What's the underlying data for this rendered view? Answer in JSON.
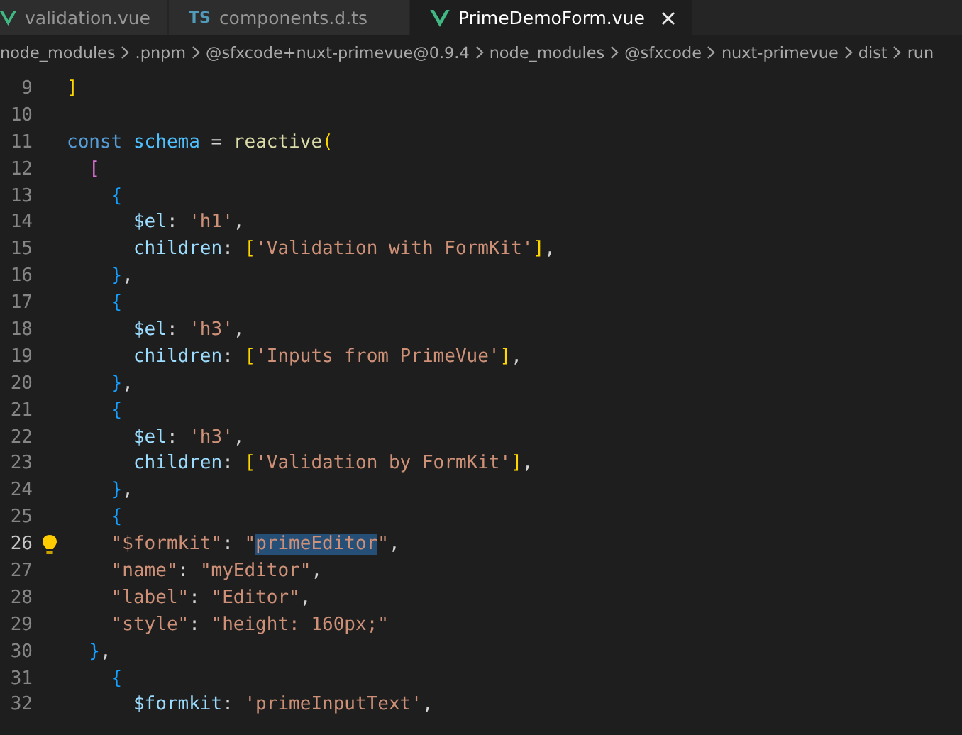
{
  "tabs": [
    {
      "label": "validation.vue",
      "kind": "vue",
      "selected": false
    },
    {
      "label": "components.d.ts",
      "kind": "ts",
      "icon_text": "TS",
      "selected": false
    },
    {
      "label": "PrimeDemoForm.vue",
      "kind": "vue",
      "selected": true
    }
  ],
  "breadcrumb": [
    "node_modules",
    ".pnpm",
    "@sfxcode+nuxt-primevue@0.9.4",
    "node_modules",
    "@sfxcode",
    "nuxt-primevue",
    "dist",
    "run"
  ],
  "lines": [
    {
      "number": "9",
      "current": false,
      "lightbulb": false,
      "tokens": [
        {
          "kind": "b1",
          "text": "]"
        }
      ]
    },
    {
      "number": "10",
      "current": false,
      "lightbulb": false
    },
    {
      "number": "11",
      "current": false,
      "lightbulb": false,
      "tokens": [
        {
          "kind": "keyword",
          "text": "const"
        },
        {
          "kind": "variable",
          "text": " schema"
        },
        {
          "kind": "punct",
          "text": " = "
        },
        {
          "kind": "function",
          "text": "reactive"
        },
        {
          "kind": "b1",
          "text": "("
        }
      ]
    },
    {
      "number": "12",
      "current": false,
      "lightbulb": false,
      "tokens": [
        {
          "kind": "b2",
          "text": "  ["
        }
      ]
    },
    {
      "number": "13",
      "current": false,
      "lightbulb": false,
      "tokens": [
        {
          "kind": "b3",
          "text": "    {"
        }
      ]
    },
    {
      "number": "14",
      "current": false,
      "lightbulb": false,
      "tokens": [
        {
          "kind": "property",
          "text": "      $el"
        },
        {
          "kind": "punct",
          "text": ": "
        },
        {
          "kind": "string",
          "text": "'h1'"
        },
        {
          "kind": "punct",
          "text": ","
        }
      ]
    },
    {
      "number": "15",
      "current": false,
      "lightbulb": false,
      "tokens": [
        {
          "kind": "property",
          "text": "      children"
        },
        {
          "kind": "punct",
          "text": ": "
        },
        {
          "kind": "b1",
          "text": "["
        },
        {
          "kind": "string",
          "text": "'Validation with FormKit'"
        },
        {
          "kind": "b1",
          "text": "]"
        },
        {
          "kind": "punct",
          "text": ","
        }
      ]
    },
    {
      "number": "16",
      "current": false,
      "lightbulb": false,
      "tokens": [
        {
          "kind": "b3",
          "text": "    }"
        },
        {
          "kind": "punct",
          "text": ","
        }
      ]
    },
    {
      "number": "17",
      "current": false,
      "lightbulb": false,
      "tokens": [
        {
          "kind": "b3",
          "text": "    {"
        }
      ]
    },
    {
      "number": "18",
      "current": false,
      "lightbulb": false,
      "tokens": [
        {
          "kind": "property",
          "text": "      $el"
        },
        {
          "kind": "punct",
          "text": ": "
        },
        {
          "kind": "string",
          "text": "'h3'"
        },
        {
          "kind": "punct",
          "text": ","
        }
      ]
    },
    {
      "number": "19",
      "current": false,
      "lightbulb": false,
      "tokens": [
        {
          "kind": "property",
          "text": "      children"
        },
        {
          "kind": "punct",
          "text": ": "
        },
        {
          "kind": "b1",
          "text": "["
        },
        {
          "kind": "string",
          "text": "'Inputs from PrimeVue'"
        },
        {
          "kind": "b1",
          "text": "]"
        },
        {
          "kind": "punct",
          "text": ","
        }
      ]
    },
    {
      "number": "20",
      "current": false,
      "lightbulb": false,
      "tokens": [
        {
          "kind": "b3",
          "text": "    }"
        },
        {
          "kind": "punct",
          "text": ","
        }
      ]
    },
    {
      "number": "21",
      "current": false,
      "lightbulb": false,
      "tokens": [
        {
          "kind": "b3",
          "text": "    {"
        }
      ]
    },
    {
      "number": "22",
      "current": false,
      "lightbulb": false,
      "tokens": [
        {
          "kind": "property",
          "text": "      $el"
        },
        {
          "kind": "punct",
          "text": ": "
        },
        {
          "kind": "string",
          "text": "'h3'"
        },
        {
          "kind": "punct",
          "text": ","
        }
      ]
    },
    {
      "number": "23",
      "current": false,
      "lightbulb": false,
      "tokens": [
        {
          "kind": "property",
          "text": "      children"
        },
        {
          "kind": "punct",
          "text": ": "
        },
        {
          "kind": "b1",
          "text": "["
        },
        {
          "kind": "string",
          "text": "'Validation by FormKit'"
        },
        {
          "kind": "b1",
          "text": "]"
        },
        {
          "kind": "punct",
          "text": ","
        }
      ]
    },
    {
      "number": "24",
      "current": false,
      "lightbulb": false,
      "tokens": [
        {
          "kind": "b3",
          "text": "    }"
        },
        {
          "kind": "punct",
          "text": ","
        }
      ]
    },
    {
      "number": "25",
      "current": false,
      "lightbulb": false,
      "tokens": [
        {
          "kind": "b3",
          "text": "    {"
        }
      ]
    },
    {
      "number": "26",
      "current": true,
      "lightbulb": true,
      "tokens": [
        {
          "kind": "string",
          "text": "    \"$formkit\""
        },
        {
          "kind": "punct",
          "text": ": "
        },
        {
          "kind": "string",
          "text": "\""
        },
        {
          "kind": "selection",
          "text": "primeEditor"
        },
        {
          "kind": "string",
          "text": "\""
        },
        {
          "kind": "punct",
          "text": ","
        }
      ]
    },
    {
      "number": "27",
      "current": false,
      "lightbulb": false,
      "tokens": [
        {
          "kind": "string",
          "text": "    \"name\""
        },
        {
          "kind": "punct",
          "text": ": "
        },
        {
          "kind": "string",
          "text": "\"myEditor\""
        },
        {
          "kind": "punct",
          "text": ","
        }
      ]
    },
    {
      "number": "28",
      "current": false,
      "lightbulb": false,
      "tokens": [
        {
          "kind": "string",
          "text": "    \"label\""
        },
        {
          "kind": "punct",
          "text": ": "
        },
        {
          "kind": "string",
          "text": "\"Editor\""
        },
        {
          "kind": "punct",
          "text": ","
        }
      ]
    },
    {
      "number": "29",
      "current": false,
      "lightbulb": false,
      "tokens": [
        {
          "kind": "string",
          "text": "    \"style\""
        },
        {
          "kind": "punct",
          "text": ": "
        },
        {
          "kind": "string",
          "text": "\"height: 160px;\""
        }
      ]
    },
    {
      "number": "30",
      "current": false,
      "lightbulb": false,
      "tokens": [
        {
          "kind": "b3",
          "text": "  }"
        },
        {
          "kind": "punct",
          "text": ","
        }
      ]
    },
    {
      "number": "31",
      "current": false,
      "lightbulb": false,
      "tokens": [
        {
          "kind": "b3",
          "text": "    {"
        }
      ]
    },
    {
      "number": "32",
      "current": false,
      "lightbulb": false,
      "tokens": [
        {
          "kind": "property",
          "text": "      $formkit"
        },
        {
          "kind": "punct",
          "text": ": "
        },
        {
          "kind": "string",
          "text": "'primeInputText'"
        },
        {
          "kind": "punct",
          "text": ","
        }
      ]
    }
  ]
}
